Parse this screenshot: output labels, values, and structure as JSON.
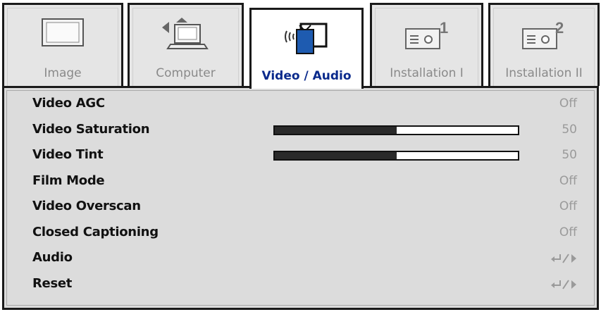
{
  "tabs": [
    {
      "label": "Image",
      "icon": "monitor-icon",
      "active": false
    },
    {
      "label": "Computer",
      "icon": "computer-input-icon",
      "active": false
    },
    {
      "label": "Video / Audio",
      "icon": "tv-audio-icon",
      "active": true
    },
    {
      "label": "Installation I",
      "icon": "projector-1-icon",
      "active": false
    },
    {
      "label": "Installation II",
      "icon": "projector-2-icon",
      "active": false
    }
  ],
  "menu": [
    {
      "label": "Video AGC",
      "value": "Off"
    },
    {
      "label": "Video Saturation",
      "value": "50",
      "slider_fraction": 0.5
    },
    {
      "label": "Video Tint",
      "value": "50",
      "slider_fraction": 0.5
    },
    {
      "label": "Film Mode",
      "value": "Off"
    },
    {
      "label": "Video Overscan",
      "value": "Off"
    },
    {
      "label": "Closed Captioning",
      "value": "Off"
    },
    {
      "label": "Audio",
      "value_icon": "enter-right-icon"
    },
    {
      "label": "Reset",
      "value_icon": "enter-right-icon"
    }
  ],
  "colors": {
    "active_tab_text": "#0a2a8c",
    "panel_bg": "#dcdcdc",
    "inactive_text": "#8a8a8a"
  }
}
